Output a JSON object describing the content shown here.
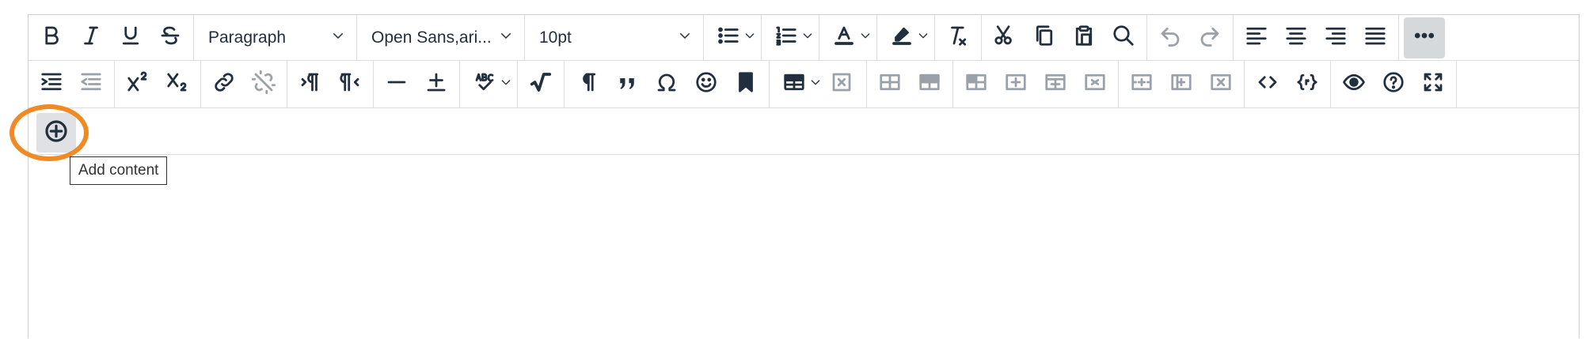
{
  "toolbar": {
    "block_format": "Paragraph",
    "font_family": "Open Sans,ari...",
    "font_size": "10pt"
  },
  "tooltip": {
    "text": "Add content"
  },
  "colors": {
    "highlight": "#f08a24",
    "icon": "#222f3e",
    "disabled": "#9aa1a8",
    "pressed": "#d6d9dc"
  },
  "icons": [
    "bold-icon",
    "italic-icon",
    "underline-icon",
    "strikethrough-icon",
    "bullet-list-icon",
    "numbered-list-icon",
    "text-color-icon",
    "highlight-color-icon",
    "clear-formatting-icon",
    "cut-icon",
    "copy-icon",
    "paste-icon",
    "search-icon",
    "undo-icon",
    "redo-icon",
    "align-left-icon",
    "align-center-icon",
    "align-right-icon",
    "justify-icon",
    "more-icon",
    "indent-icon",
    "outdent-icon",
    "superscript-icon",
    "subscript-icon",
    "link-icon",
    "unlink-icon",
    "ltr-icon",
    "rtl-icon",
    "horizontal-rule-icon",
    "insert-anchor-icon",
    "spellcheck-icon",
    "math-icon",
    "paragraph-mark-icon",
    "quote-icon",
    "omega-icon",
    "emoji-icon",
    "bookmark-icon",
    "table-icon",
    "delete-table-icon",
    "table-row-icon",
    "table-column-icon",
    "code-icon",
    "code-sample-icon",
    "preview-icon",
    "help-icon",
    "fullscreen-icon",
    "add-content-icon"
  ]
}
